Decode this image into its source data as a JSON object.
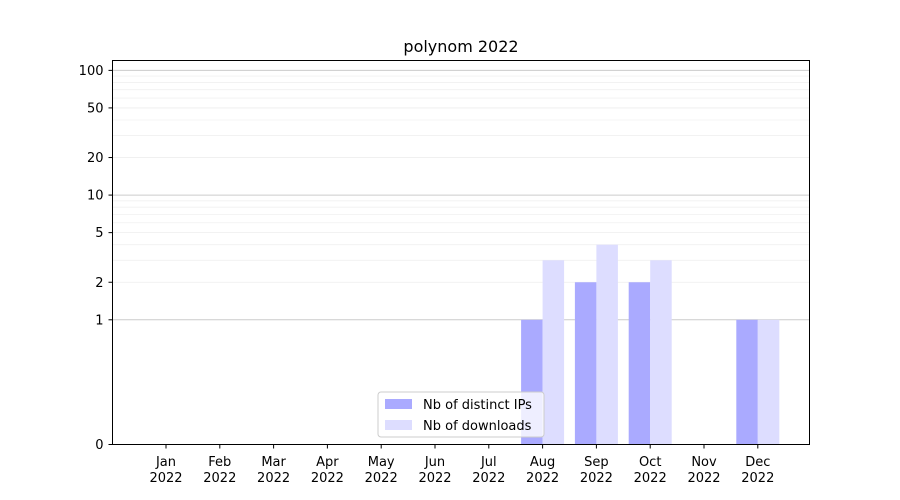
{
  "chart_data": {
    "type": "bar",
    "title": "polynom 2022",
    "xlabel": "",
    "ylabel": "",
    "y_scale": "symlog",
    "ylim": [
      0,
      120
    ],
    "y_ticks": [
      0,
      1,
      2,
      5,
      10,
      20,
      50,
      100
    ],
    "y_tick_labels": [
      "0",
      "1",
      "2",
      "5",
      "10",
      "20",
      "50",
      "100"
    ],
    "categories": [
      [
        "Jan",
        "2022"
      ],
      [
        "Feb",
        "2022"
      ],
      [
        "Mar",
        "2022"
      ],
      [
        "Apr",
        "2022"
      ],
      [
        "May",
        "2022"
      ],
      [
        "Jun",
        "2022"
      ],
      [
        "Jul",
        "2022"
      ],
      [
        "Aug",
        "2022"
      ],
      [
        "Sep",
        "2022"
      ],
      [
        "Oct",
        "2022"
      ],
      [
        "Nov",
        "2022"
      ],
      [
        "Dec",
        "2022"
      ]
    ],
    "series": [
      {
        "name": "Nb of distinct IPs",
        "color": "#aaaaff",
        "values": [
          0,
          0,
          0,
          0,
          0,
          0,
          0,
          1,
          2,
          2,
          0,
          1
        ]
      },
      {
        "name": "Nb of downloads",
        "color": "#ddddff",
        "values": [
          0,
          0,
          0,
          0,
          0,
          0,
          0,
          3,
          4,
          3,
          0,
          1
        ]
      }
    ],
    "grid": true,
    "legend": "lower-center"
  }
}
